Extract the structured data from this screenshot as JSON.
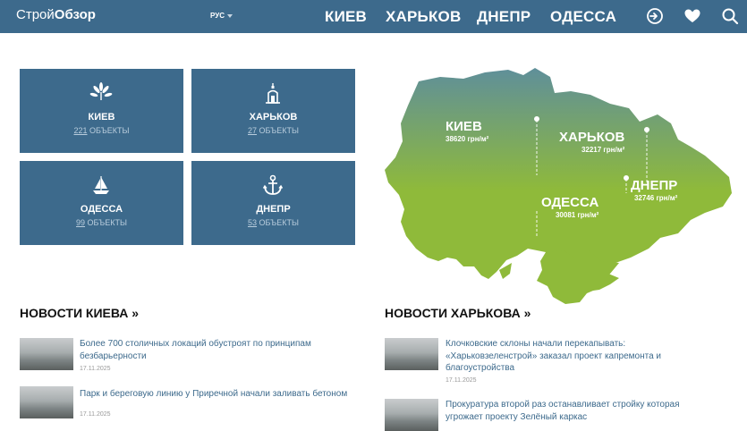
{
  "header": {
    "logo_light": "Строй",
    "logo_bold": "Обзор",
    "lang": "РУС",
    "nav": [
      "КИЕВ",
      "ХАРЬКОВ",
      "ДНЕПР",
      "ОДЕССА"
    ],
    "icons": [
      "login-icon",
      "heart-icon",
      "search-icon"
    ]
  },
  "cards": [
    {
      "name": "КИЕВ",
      "count": "221",
      "suffix": " ОБЪЕКТЫ",
      "icon": "chestnut-leaf-icon"
    },
    {
      "name": "ХАРЬКОВ",
      "count": "27",
      "suffix": " ОБЪЕКТЫ",
      "icon": "monument-icon"
    },
    {
      "name": "ОДЕССА",
      "count": "99",
      "suffix": " ОБЪЕКТЫ",
      "icon": "sailboat-icon"
    },
    {
      "name": "ДНЕПР",
      "count": "53",
      "suffix": " ОБЪЕКТЫ",
      "icon": "anchor-icon"
    }
  ],
  "map": {
    "cities": [
      {
        "name": "КИЕВ",
        "price": "38620 грн/м²"
      },
      {
        "name": "ХАРЬКОВ",
        "price": "32217 грн/м²"
      },
      {
        "name": "ОДЕССА",
        "price": "30081 грн/м²"
      },
      {
        "name": "ДНЕПР",
        "price": "32746 грн/м²"
      }
    ],
    "colors": {
      "top": "#5f8f9a",
      "bottom": "#8fba3a"
    }
  },
  "sections": {
    "kiev": "НОВОСТИ КИЕВА »",
    "kharkov": "НОВОСТИ ХАРЬКОВА »"
  },
  "news_kiev": [
    {
      "title_1": "Более 700 столичных локаций обустроят по принципам",
      "title_2": "безбарьерности",
      "date": "17.11.2025"
    },
    {
      "title_1": "Парк и береговую линию у Приречной начали заливать бетоном",
      "title_2": "",
      "date": "17.11.2025"
    }
  ],
  "news_kharkov": [
    {
      "title_1": "Клочковские склоны начали перекапывать:",
      "title_2": "«Харьковзеленстрой» заказал проект капремонта и",
      "title_3": "благоустройства",
      "date": "17.11.2025"
    },
    {
      "title_1": "Прокуратура второй раз останавливает стройку которая",
      "title_2": "угрожает проекту Зелёный каркас",
      "date": ""
    }
  ]
}
